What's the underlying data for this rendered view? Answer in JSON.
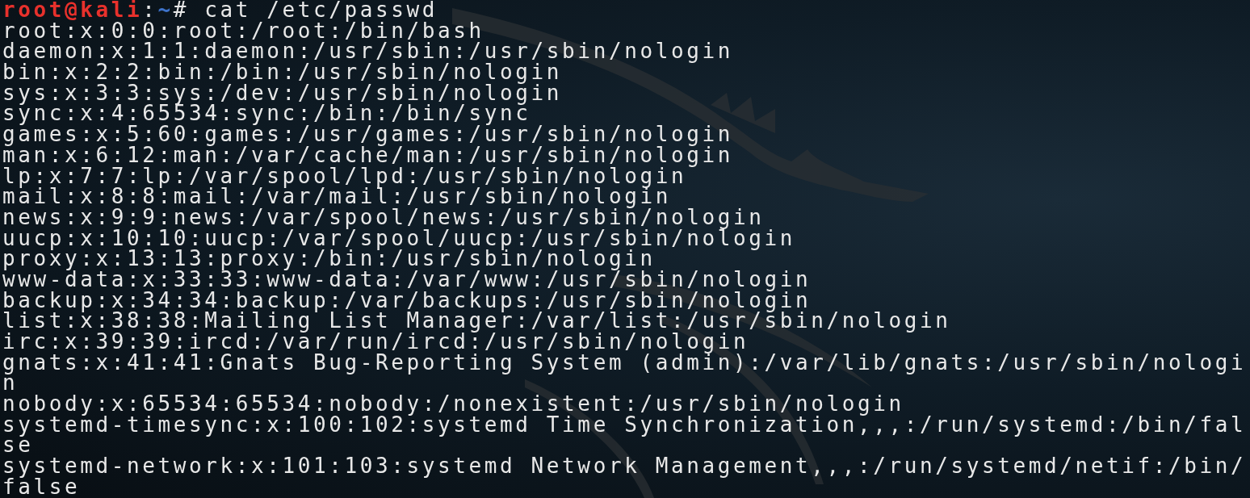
{
  "prompt": {
    "user_host": "root@kali",
    "separator": ":",
    "path": "~",
    "symbol": "#",
    "command": "cat /etc/passwd"
  },
  "output_lines": [
    "root:x:0:0:root:/root:/bin/bash",
    "daemon:x:1:1:daemon:/usr/sbin:/usr/sbin/nologin",
    "bin:x:2:2:bin:/bin:/usr/sbin/nologin",
    "sys:x:3:3:sys:/dev:/usr/sbin/nologin",
    "sync:x:4:65534:sync:/bin:/bin/sync",
    "games:x:5:60:games:/usr/games:/usr/sbin/nologin",
    "man:x:6:12:man:/var/cache/man:/usr/sbin/nologin",
    "lp:x:7:7:lp:/var/spool/lpd:/usr/sbin/nologin",
    "mail:x:8:8:mail:/var/mail:/usr/sbin/nologin",
    "news:x:9:9:news:/var/spool/news:/usr/sbin/nologin",
    "uucp:x:10:10:uucp:/var/spool/uucp:/usr/sbin/nologin",
    "proxy:x:13:13:proxy:/bin:/usr/sbin/nologin",
    "www-data:x:33:33:www-data:/var/www:/usr/sbin/nologin",
    "backup:x:34:34:backup:/var/backups:/usr/sbin/nologin",
    "list:x:38:38:Mailing List Manager:/var/list:/usr/sbin/nologin",
    "irc:x:39:39:ircd:/var/run/ircd:/usr/sbin/nologin",
    "gnats:x:41:41:Gnats Bug-Reporting System (admin):/var/lib/gnats:/usr/sbin/nologi",
    "n",
    "nobody:x:65534:65534:nobody:/nonexistent:/usr/sbin/nologin",
    "systemd-timesync:x:100:102:systemd Time Synchronization,,,:/run/systemd:/bin/fal",
    "se",
    "systemd-network:x:101:103:systemd Network Management,,,:/run/systemd/netif:/bin/",
    "false"
  ]
}
